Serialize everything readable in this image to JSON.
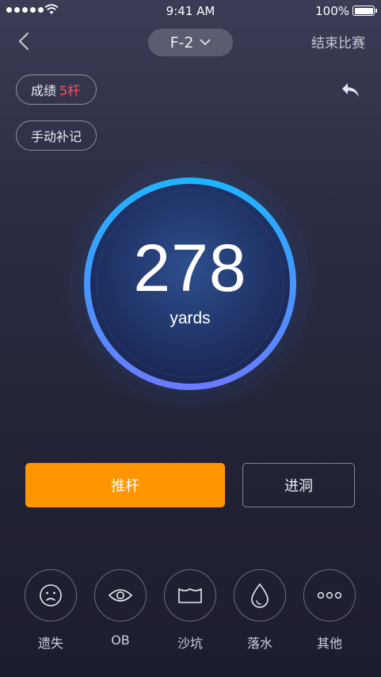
{
  "status": {
    "time": "9:41 AM",
    "battery": "100%"
  },
  "nav": {
    "hole": "F-2",
    "end_match": "结束比赛"
  },
  "score": {
    "label": "成绩",
    "value": "5杆"
  },
  "manual_record": "手动补记",
  "distance": {
    "value": "278",
    "unit": "yards"
  },
  "actions": {
    "putt": "推杆",
    "hole_in": "进洞"
  },
  "penalties": [
    {
      "label": "遗失",
      "icon": "sad-face-icon"
    },
    {
      "label": "OB",
      "icon": "eye-icon"
    },
    {
      "label": "沙坑",
      "icon": "bunker-icon"
    },
    {
      "label": "落水",
      "icon": "water-drop-icon"
    },
    {
      "label": "其他",
      "icon": "more-icon"
    }
  ],
  "colors": {
    "accent": "#ff9500",
    "score_red": "#ff4d5c",
    "ring_start": "#1fb4ff",
    "ring_end": "#6a7bff"
  }
}
